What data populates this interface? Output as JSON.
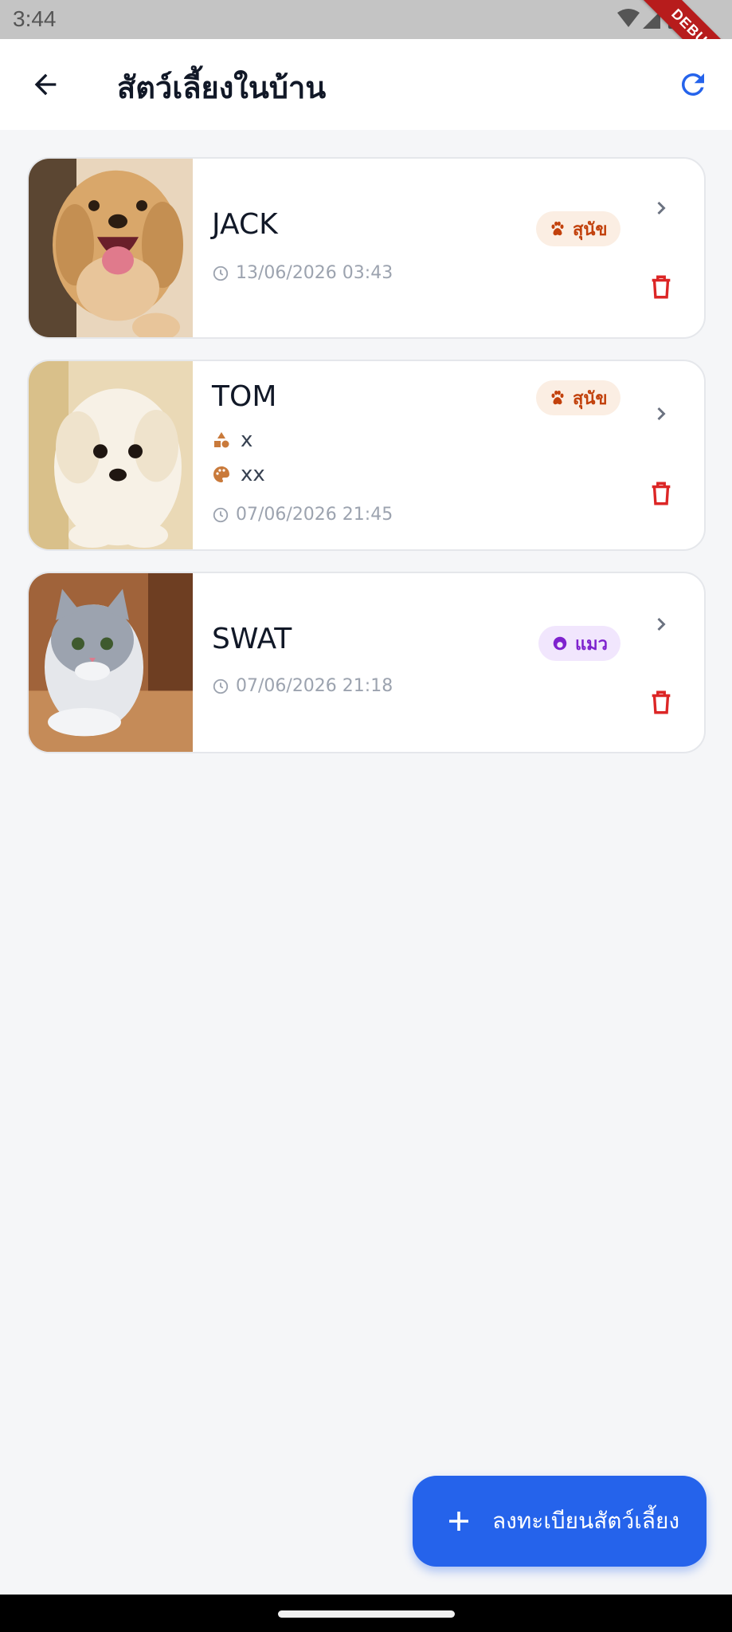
{
  "status_bar": {
    "time": "3:44",
    "debug_label": "DEBUG"
  },
  "app_bar": {
    "title": "สัตว์เลี้ยงในบ้าน"
  },
  "pets": [
    {
      "name": "JACK",
      "type_label": "สุนัข",
      "type": "dog",
      "date": "13/06/2026 03:43",
      "breed": null,
      "color": null
    },
    {
      "name": "TOM",
      "type_label": "สุนัข",
      "type": "dog",
      "date": "07/06/2026 21:45",
      "breed": "x",
      "color": "xx"
    },
    {
      "name": "SWAT",
      "type_label": "แมว",
      "type": "cat",
      "date": "07/06/2026 21:18",
      "breed": null,
      "color": null
    }
  ],
  "fab": {
    "label": "ลงทะเบียนสัตว์เลี้ยง"
  },
  "colors": {
    "primary": "#2563eb",
    "delete": "#dc2626",
    "dog_badge_bg": "#fbeee3",
    "dog_badge_text": "#c2410c",
    "cat_badge_bg": "#f1e6fd",
    "cat_badge_text": "#7e22ce",
    "background": "#f5f6f8"
  }
}
